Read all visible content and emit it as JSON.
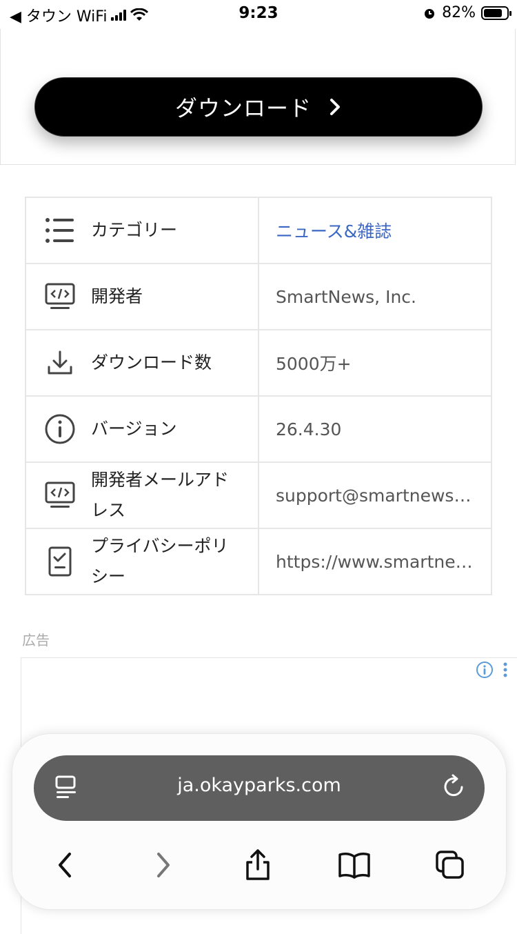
{
  "status_bar": {
    "back_app": "◀ タウン WiFi",
    "time": "9:23",
    "battery": "82%"
  },
  "download": {
    "label": "ダウンロード"
  },
  "info_rows": [
    {
      "icon": "list-icon",
      "label": "カテゴリー",
      "value": "ニュース&雑誌",
      "is_link": true
    },
    {
      "icon": "developer-icon",
      "label": "開発者",
      "value": "SmartNews, Inc.",
      "is_link": false
    },
    {
      "icon": "download-icon",
      "label": "ダウンロード数",
      "value": "5000万+",
      "is_link": false
    },
    {
      "icon": "info-icon",
      "label": "バージョン",
      "value": "26.4.30",
      "is_link": false
    },
    {
      "icon": "developer-icon",
      "label": "開発者メールアドレス",
      "value": "support@smartnews…",
      "is_link": false
    },
    {
      "icon": "checklist-icon",
      "label": "プライバシーポリシー",
      "value": "https://www.smartne…",
      "is_link": false
    }
  ],
  "ad": {
    "label": "広告"
  },
  "browser": {
    "url": "ja.okayparks.com",
    "accent": "#5f5f5f"
  },
  "colors": {
    "link": "#3a66c4",
    "button_bg": "#000000"
  }
}
